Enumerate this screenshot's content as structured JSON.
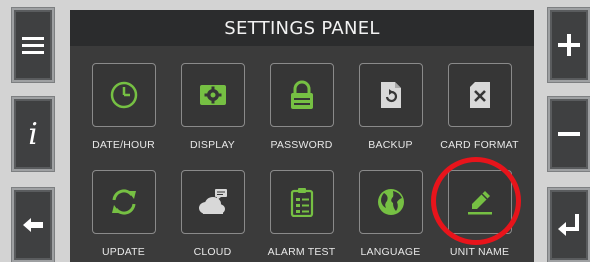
{
  "panel": {
    "title": "SETTINGS PANEL"
  },
  "tiles": [
    {
      "label": "DATE/HOUR",
      "icon": "clock-icon"
    },
    {
      "label": "DISPLAY",
      "icon": "display-gear-icon"
    },
    {
      "label": "PASSWORD",
      "icon": "padlock-icon"
    },
    {
      "label": "BACKUP",
      "icon": "backup-file-icon"
    },
    {
      "label": "CARD FORMAT",
      "icon": "card-format-icon"
    },
    {
      "label": "UPDATE",
      "icon": "refresh-icon"
    },
    {
      "label": "CLOUD",
      "icon": "cloud-icon"
    },
    {
      "label": "ALARM TEST",
      "icon": "clipboard-checklist-icon"
    },
    {
      "label": "LANGUAGE",
      "icon": "globe-icon"
    },
    {
      "label": "UNIT NAME",
      "icon": "pencil-edit-icon"
    }
  ],
  "side_buttons": {
    "left": [
      "menu-icon",
      "info-icon",
      "back-arrow-icon"
    ],
    "right": [
      "plus-icon",
      "minus-icon",
      "enter-icon"
    ]
  },
  "colors": {
    "accent_green": "#76c043",
    "highlight_red": "#e8141b",
    "panel_bg": "#3b3b3b"
  }
}
